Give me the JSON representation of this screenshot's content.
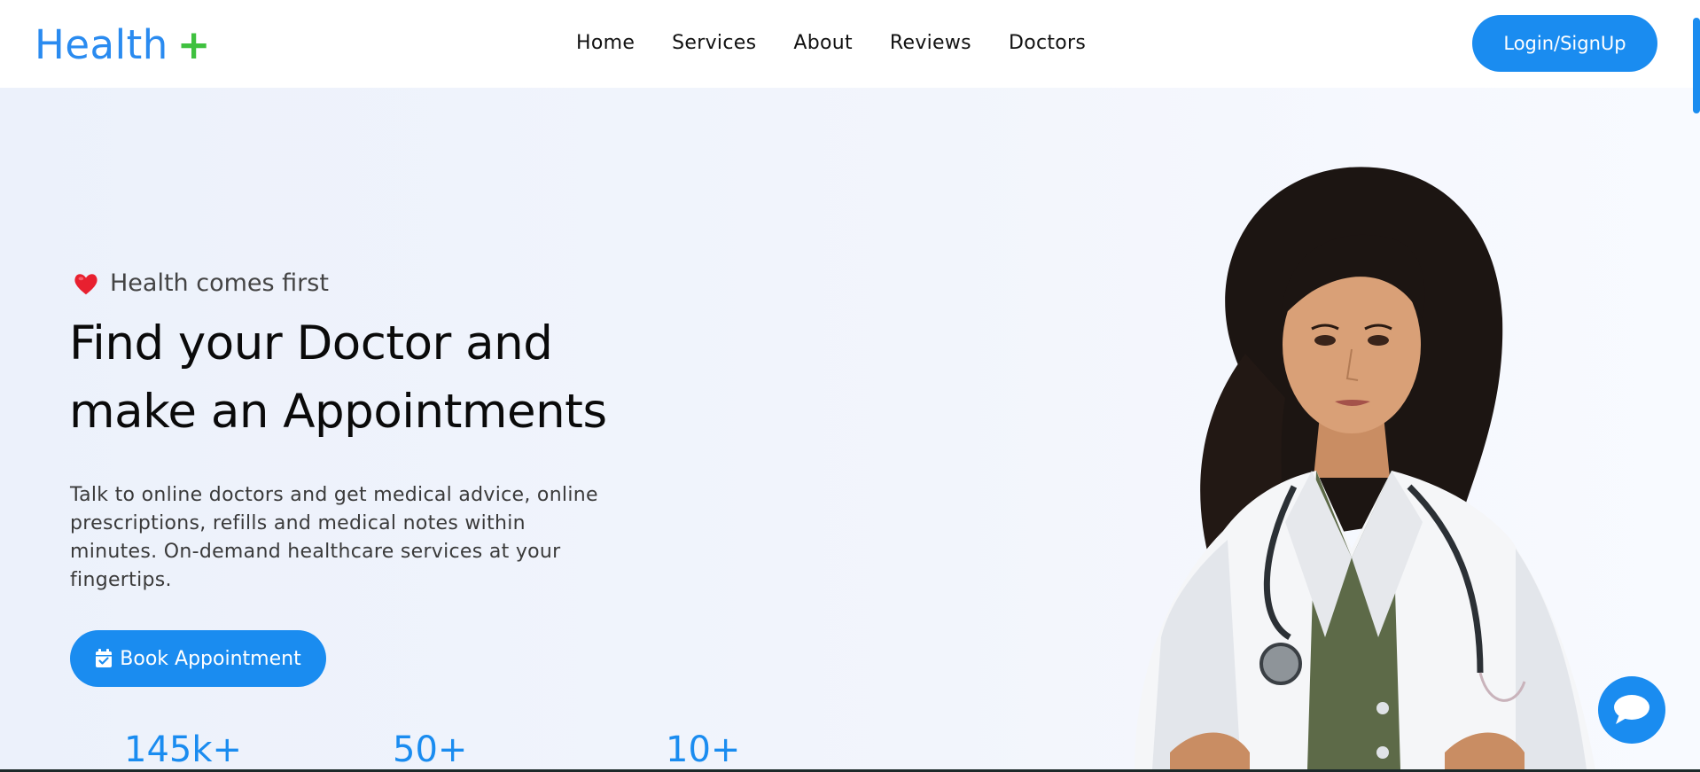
{
  "brand": {
    "name": "Health",
    "plus": "+"
  },
  "nav": {
    "items": [
      {
        "label": "Home"
      },
      {
        "label": "Services"
      },
      {
        "label": "About"
      },
      {
        "label": "Reviews"
      },
      {
        "label": "Doctors"
      }
    ],
    "login_label": "Login/SignUp"
  },
  "hero": {
    "tagline": "Health comes first",
    "title_line1": "Find your Doctor and",
    "title_line2": "make an Appointments",
    "description": "Talk to online doctors and get medical advice, online prescriptions, refills and medical notes within minutes. On-demand healthcare services at your fingertips.",
    "book_label": "Book Appointment"
  },
  "stats": [
    {
      "value": "145k+"
    },
    {
      "value": "50+"
    },
    {
      "value": "10+"
    }
  ],
  "icons": {
    "tagline": "heart-icon",
    "book": "calendar-check-icon",
    "chat": "chat-bubble-icon"
  },
  "colors": {
    "accent": "#1a8cf0",
    "logo_plus": "#3fc13f",
    "heart": "#e8202f",
    "hero_bg": "#eef2fb"
  }
}
